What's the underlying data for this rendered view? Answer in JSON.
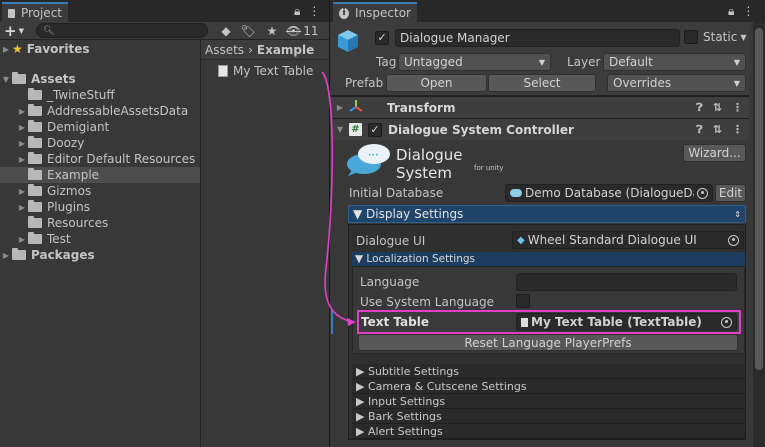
{
  "project": {
    "tab": "Project",
    "hidden_count": "11",
    "search_placeholder": "",
    "tree": [
      {
        "label": "Favorites"
      },
      {
        "label": "Assets"
      },
      {
        "label": "_TwineStuff"
      },
      {
        "label": "AddressableAssetsData"
      },
      {
        "label": "Demigiant"
      },
      {
        "label": "Doozy"
      },
      {
        "label": "Editor Default Resources"
      },
      {
        "label": "Example"
      },
      {
        "label": "Gizmos"
      },
      {
        "label": "Plugins"
      },
      {
        "label": "Resources"
      },
      {
        "label": "Test"
      },
      {
        "label": "Packages"
      }
    ],
    "breadcrumb": {
      "root": "Assets",
      "separator": "›",
      "current": "Example"
    },
    "file": "My Text Table"
  },
  "inspector": {
    "tab": "Inspector",
    "object_name": "Dialogue Manager",
    "static_label": "Static",
    "tag_label": "Tag",
    "tag_value": "Untagged",
    "layer_label": "Layer",
    "layer_value": "Default",
    "prefab_label": "Prefab",
    "open_label": "Open",
    "select_label": "Select",
    "overrides_label": "Overrides",
    "transform_label": "Transform",
    "dsc_label": "Dialogue System Controller",
    "logo_title": "Dialogue System",
    "logo_sub": "for unity",
    "wizard_label": "Wizard...",
    "initial_db_label": "Initial Database",
    "initial_db_value": "Demo Database (DialogueData",
    "edit_label": "Edit",
    "display_settings": "▼ Display Settings",
    "dialogue_ui_label": "Dialogue UI",
    "dialogue_ui_value": "Wheel Standard Dialogue UI",
    "localization_settings": "▼ Localization Settings",
    "language_label": "Language",
    "language_value": "",
    "use_system_language_label": "Use System Language",
    "text_table_label": "Text Table",
    "text_table_value": "My Text Table (TextTable)",
    "reset_label": "Reset Language PlayerPrefs",
    "sections": [
      "▶ Subtitle Settings",
      "▶ Camera & Cutscene Settings",
      "▶ Input Settings",
      "▶ Bark Settings",
      "▶ Alert Settings"
    ]
  },
  "colors": {
    "highlight": "#e040c8",
    "accent_blue": "#3a79bb",
    "selection": "#2c5d87"
  }
}
